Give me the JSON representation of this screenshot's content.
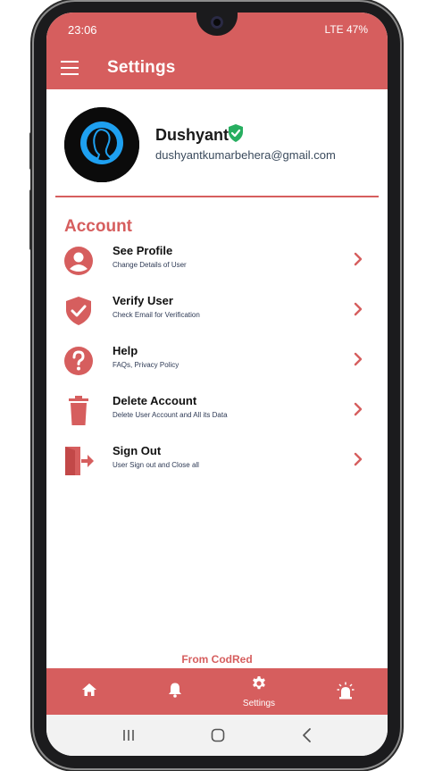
{
  "status_bar": {
    "time": "23:06",
    "right": "LTE 47%"
  },
  "app_bar": {
    "title": "Settings"
  },
  "profile": {
    "name": "Dushyant",
    "email": "dushyantkumarbehera@gmail.com"
  },
  "section": {
    "title": "Account"
  },
  "menu_items": [
    {
      "title": "See Profile",
      "subtitle": "Change Details of User",
      "icon": "user-circle-icon"
    },
    {
      "title": "Verify User",
      "subtitle": "Check Email for Verification",
      "icon": "shield-check-icon"
    },
    {
      "title": "Help",
      "subtitle": "FAQs, Privacy Policy",
      "icon": "help-circle-icon"
    },
    {
      "title": "Delete Account",
      "subtitle": "Delete User Account and All its Data",
      "icon": "trash-icon"
    },
    {
      "title": "Sign Out",
      "subtitle": "User Sign out and Close all",
      "icon": "exit-door-icon"
    }
  ],
  "footer": {
    "credit": "From CodRed"
  },
  "bottom_nav": {
    "settings_label": "Settings"
  },
  "colors": {
    "primary": "#d65e5e",
    "verified": "#27ae60",
    "avatar_accent": "#1ea0f0"
  }
}
